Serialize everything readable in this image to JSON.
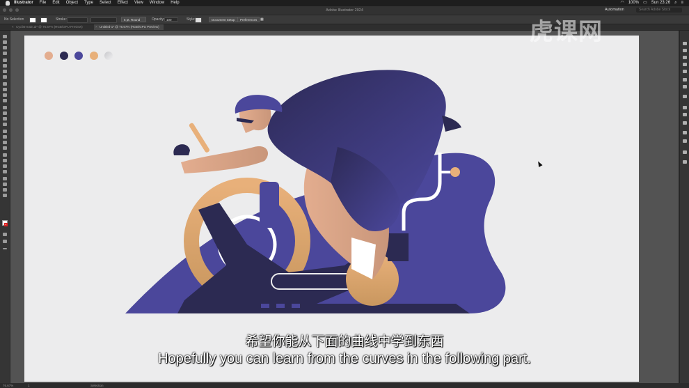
{
  "menubar": {
    "app_name": "Illustrator",
    "items": [
      "File",
      "Edit",
      "Object",
      "Type",
      "Select",
      "Effect",
      "View",
      "Window",
      "Help"
    ],
    "battery": "100%",
    "clock": "Sun 23:26"
  },
  "titlebar": {
    "window_title": "Adobe Illustrator 2024",
    "workspace": "Automation",
    "search_placeholder": "Search Adobe Stock"
  },
  "controlbar": {
    "selection": "No Selection",
    "stroke_label": "Stroke:",
    "brush_style": "5 pt. Round",
    "opacity_label": "Opacity:",
    "opacity_value": "100",
    "style_label": "Style:",
    "document_setup": "Document Setup",
    "preferences": "Preferences"
  },
  "tabs": [
    {
      "label": "Cyclist-main.ai* @ 76.67% (RGB/GPU Preview)",
      "active": false
    },
    {
      "label": "Untitled-1* @ 76.67% (RGB/GPU Preview)",
      "active": true
    }
  ],
  "statusbar": {
    "zoom": "76.67%",
    "artboard": "1",
    "tool": "Selection"
  },
  "palette": [
    "#e3ad8f",
    "#2c2a52",
    "#4b479b",
    "#e8b07a"
  ],
  "watermark": "虎课网",
  "subtitles": {
    "chinese": "希望你能从下面的曲线中学到东西",
    "english": "Hopefully you can learn from the curves in the following part."
  }
}
